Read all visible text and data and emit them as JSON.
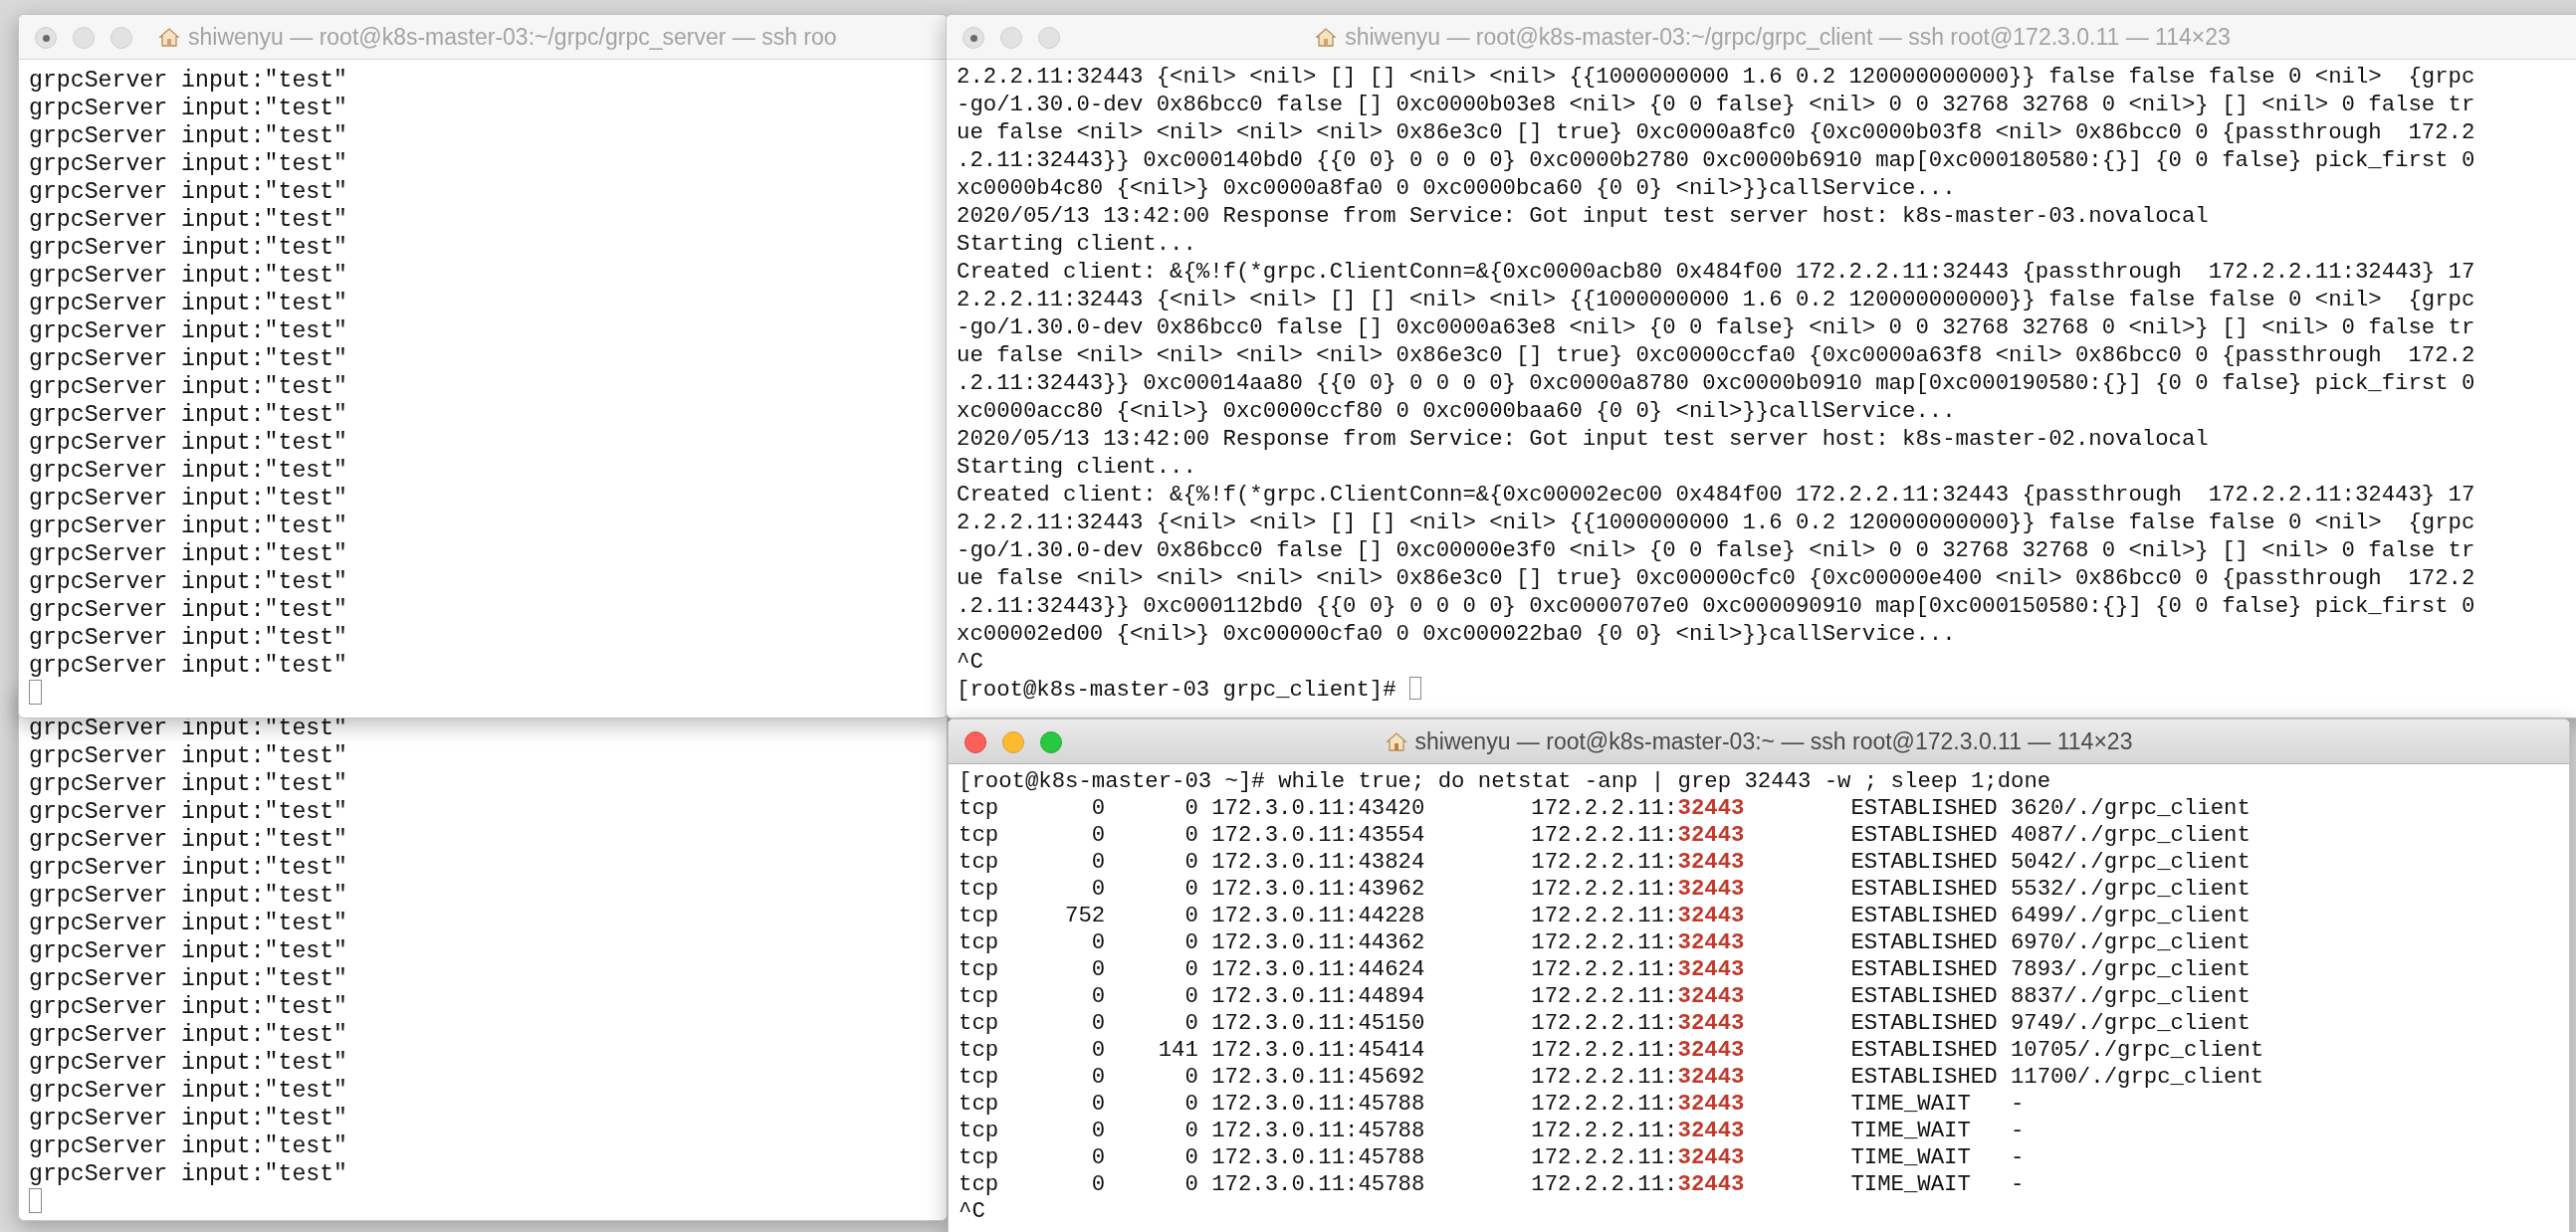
{
  "server_window": {
    "title": "shiwenyu — root@k8s-master-03:~/grpc/grpc_server — ssh roo",
    "active": false,
    "lines": [
      "grpcServer input:\"test\"",
      "grpcServer input:\"test\"",
      "grpcServer input:\"test\"",
      "grpcServer input:\"test\"",
      "grpcServer input:\"test\"",
      "grpcServer input:\"test\"",
      "grpcServer input:\"test\"",
      "grpcServer input:\"test\"",
      "grpcServer input:\"test\"",
      "grpcServer input:\"test\"",
      "grpcServer input:\"test\"",
      "grpcServer input:\"test\"",
      "grpcServer input:\"test\"",
      "grpcServer input:\"test\"",
      "grpcServer input:\"test\"",
      "grpcServer input:\"test\"",
      "grpcServer input:\"test\"",
      "grpcServer input:\"test\"",
      "grpcServer input:\"test\"",
      "grpcServer input:\"test\"",
      "grpcServer input:\"test\"",
      "grpcServer input:\"test\""
    ]
  },
  "server_window_behind": {
    "lines": [
      "grpcServer input:\"test\"",
      "grpcServer input:\"test\"",
      "grpcServer input:\"test\"",
      "grpcServer input:\"test\"",
      "grpcServer input:\"test\"",
      "grpcServer input:\"test\"",
      "grpcServer input:\"test\"",
      "grpcServer input:\"test\"",
      "grpcServer input:\"test\"",
      "grpcServer input:\"test\"",
      "grpcServer input:\"test\"",
      "grpcServer input:\"test\"",
      "grpcServer input:\"test\"",
      "grpcServer input:\"test\"",
      "grpcServer input:\"test\"",
      "grpcServer input:\"test\"",
      "grpcServer input:\"test\""
    ]
  },
  "client_window": {
    "title": "shiwenyu — root@k8s-master-03:~/grpc/grpc_client — ssh root@172.3.0.11 — 114×23",
    "active": false,
    "lines": [
      "2.2.2.11:32443 {<nil> <nil> [] [] <nil> <nil> {{1000000000 1.6 0.2 120000000000}} false false false 0 <nil>  {grpc",
      "-go/1.30.0-dev 0x86bcc0 false [] 0xc0000b03e8 <nil> {0 0 false} <nil> 0 0 32768 32768 0 <nil>} [] <nil> 0 false tr",
      "ue false <nil> <nil> <nil> <nil> 0x86e3c0 [] true} 0xc0000a8fc0 {0xc0000b03f8 <nil> 0x86bcc0 0 {passthrough  172.2",
      ".2.11:32443}} 0xc000140bd0 {{0 0} 0 0 0 0} 0xc0000b2780 0xc0000b6910 map[0xc000180580:{}] {0 0 false} pick_first 0",
      "xc0000b4c80 {<nil>} 0xc0000a8fa0 0 0xc0000bca60 {0 0} <nil>}}callService...",
      "2020/05/13 13:42:00 Response from Service: Got input test server host: k8s-master-03.novalocal",
      "Starting client...",
      "Created client: &{%!f(*grpc.ClientConn=&{0xc0000acb80 0x484f00 172.2.2.11:32443 {passthrough  172.2.2.11:32443} 17",
      "2.2.2.11:32443 {<nil> <nil> [] [] <nil> <nil> {{1000000000 1.6 0.2 120000000000}} false false false 0 <nil>  {grpc",
      "-go/1.30.0-dev 0x86bcc0 false [] 0xc0000a63e8 <nil> {0 0 false} <nil> 0 0 32768 32768 0 <nil>} [] <nil> 0 false tr",
      "ue false <nil> <nil> <nil> <nil> 0x86e3c0 [] true} 0xc0000ccfa0 {0xc0000a63f8 <nil> 0x86bcc0 0 {passthrough  172.2",
      ".2.11:32443}} 0xc00014aa80 {{0 0} 0 0 0 0} 0xc0000a8780 0xc0000b0910 map[0xc000190580:{}] {0 0 false} pick_first 0",
      "xc0000acc80 {<nil>} 0xc0000ccf80 0 0xc0000baa60 {0 0} <nil>}}callService...",
      "2020/05/13 13:42:00 Response from Service: Got input test server host: k8s-master-02.novalocal",
      "Starting client...",
      "Created client: &{%!f(*grpc.ClientConn=&{0xc00002ec00 0x484f00 172.2.2.11:32443 {passthrough  172.2.2.11:32443} 17",
      "2.2.2.11:32443 {<nil> <nil> [] [] <nil> <nil> {{1000000000 1.6 0.2 120000000000}} false false false 0 <nil>  {grpc",
      "-go/1.30.0-dev 0x86bcc0 false [] 0xc00000e3f0 <nil> {0 0 false} <nil> 0 0 32768 32768 0 <nil>} [] <nil> 0 false tr",
      "ue false <nil> <nil> <nil> <nil> 0x86e3c0 [] true} 0xc00000cfc0 {0xc00000e400 <nil> 0x86bcc0 0 {passthrough  172.2",
      ".2.11:32443}} 0xc000112bd0 {{0 0} 0 0 0 0} 0xc0000707e0 0xc000090910 map[0xc000150580:{}] {0 0 false} pick_first 0",
      "xc00002ed00 {<nil>} 0xc00000cfa0 0 0xc000022ba0 {0 0} <nil>}}callService...",
      "^C",
      "[root@k8s-master-03 grpc_client]#"
    ]
  },
  "netstat_window": {
    "title": "shiwenyu — root@k8s-master-03:~ — ssh root@172.3.0.11 — 114×23",
    "active": true,
    "command": "[root@k8s-master-03 ~]# while true; do netstat -anp | grep 32443 -w ; sleep 1;done",
    "rows": [
      {
        "proto": "tcp",
        "recv_q": "0",
        "send_q": "0",
        "local": "172.3.0.11:43420",
        "foreign_host": "172.2.2.11:",
        "foreign_port": "32443",
        "state": "ESTABLISHED",
        "program": "3620/./grpc_client"
      },
      {
        "proto": "tcp",
        "recv_q": "0",
        "send_q": "0",
        "local": "172.3.0.11:43554",
        "foreign_host": "172.2.2.11:",
        "foreign_port": "32443",
        "state": "ESTABLISHED",
        "program": "4087/./grpc_client"
      },
      {
        "proto": "tcp",
        "recv_q": "0",
        "send_q": "0",
        "local": "172.3.0.11:43824",
        "foreign_host": "172.2.2.11:",
        "foreign_port": "32443",
        "state": "ESTABLISHED",
        "program": "5042/./grpc_client"
      },
      {
        "proto": "tcp",
        "recv_q": "0",
        "send_q": "0",
        "local": "172.3.0.11:43962",
        "foreign_host": "172.2.2.11:",
        "foreign_port": "32443",
        "state": "ESTABLISHED",
        "program": "5532/./grpc_client"
      },
      {
        "proto": "tcp",
        "recv_q": "752",
        "send_q": "0",
        "local": "172.3.0.11:44228",
        "foreign_host": "172.2.2.11:",
        "foreign_port": "32443",
        "state": "ESTABLISHED",
        "program": "6499/./grpc_client"
      },
      {
        "proto": "tcp",
        "recv_q": "0",
        "send_q": "0",
        "local": "172.3.0.11:44362",
        "foreign_host": "172.2.2.11:",
        "foreign_port": "32443",
        "state": "ESTABLISHED",
        "program": "6970/./grpc_client"
      },
      {
        "proto": "tcp",
        "recv_q": "0",
        "send_q": "0",
        "local": "172.3.0.11:44624",
        "foreign_host": "172.2.2.11:",
        "foreign_port": "32443",
        "state": "ESTABLISHED",
        "program": "7893/./grpc_client"
      },
      {
        "proto": "tcp",
        "recv_q": "0",
        "send_q": "0",
        "local": "172.3.0.11:44894",
        "foreign_host": "172.2.2.11:",
        "foreign_port": "32443",
        "state": "ESTABLISHED",
        "program": "8837/./grpc_client"
      },
      {
        "proto": "tcp",
        "recv_q": "0",
        "send_q": "0",
        "local": "172.3.0.11:45150",
        "foreign_host": "172.2.2.11:",
        "foreign_port": "32443",
        "state": "ESTABLISHED",
        "program": "9749/./grpc_client"
      },
      {
        "proto": "tcp",
        "recv_q": "0",
        "send_q": "141",
        "local": "172.3.0.11:45414",
        "foreign_host": "172.2.2.11:",
        "foreign_port": "32443",
        "state": "ESTABLISHED",
        "program": "10705/./grpc_client"
      },
      {
        "proto": "tcp",
        "recv_q": "0",
        "send_q": "0",
        "local": "172.3.0.11:45692",
        "foreign_host": "172.2.2.11:",
        "foreign_port": "32443",
        "state": "ESTABLISHED",
        "program": "11700/./grpc_client"
      },
      {
        "proto": "tcp",
        "recv_q": "0",
        "send_q": "0",
        "local": "172.3.0.11:45788",
        "foreign_host": "172.2.2.11:",
        "foreign_port": "32443",
        "state": "TIME_WAIT",
        "program": "-"
      },
      {
        "proto": "tcp",
        "recv_q": "0",
        "send_q": "0",
        "local": "172.3.0.11:45788",
        "foreign_host": "172.2.2.11:",
        "foreign_port": "32443",
        "state": "TIME_WAIT",
        "program": "-"
      },
      {
        "proto": "tcp",
        "recv_q": "0",
        "send_q": "0",
        "local": "172.3.0.11:45788",
        "foreign_host": "172.2.2.11:",
        "foreign_port": "32443",
        "state": "TIME_WAIT",
        "program": "-"
      },
      {
        "proto": "tcp",
        "recv_q": "0",
        "send_q": "0",
        "local": "172.3.0.11:45788",
        "foreign_host": "172.2.2.11:",
        "foreign_port": "32443",
        "state": "TIME_WAIT",
        "program": "-"
      }
    ],
    "trailing_lines": [
      "^C"
    ]
  }
}
